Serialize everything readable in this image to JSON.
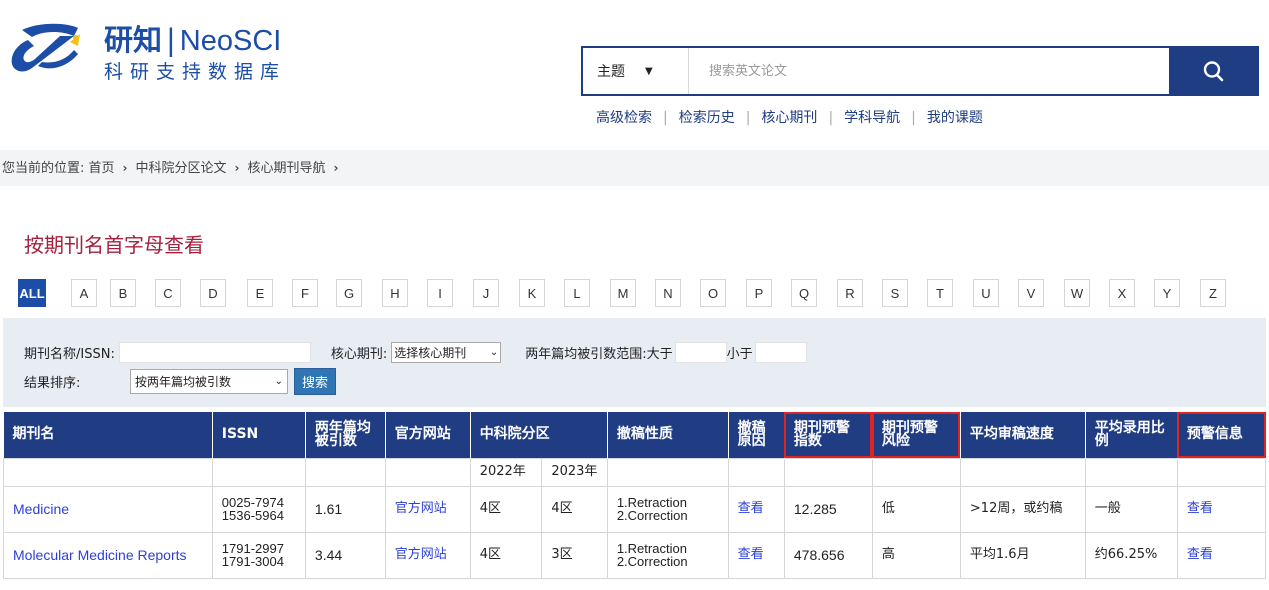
{
  "header": {
    "brand_name": "研知",
    "brand_en": "NeoSCI",
    "brand_sub": "科研支持数据库",
    "search": {
      "type_selected": "主题",
      "placeholder": "搜索英文论文"
    },
    "links": [
      "高级检索",
      "检索历史",
      "核心期刊",
      "学科导航",
      "我的课题"
    ]
  },
  "breadcrumb": {
    "prefix": "您当前的位置:",
    "items": [
      "首页",
      "中科院分区论文",
      "核心期刊导航"
    ]
  },
  "letter_nav": {
    "title": "按期刊名首字母查看",
    "letters": [
      "ALL",
      "A",
      "B",
      "C",
      "D",
      "E",
      "F",
      "G",
      "H",
      "I",
      "J",
      "K",
      "L",
      "M",
      "N",
      "O",
      "P",
      "Q",
      "R",
      "S",
      "T",
      "U",
      "V",
      "W",
      "X",
      "Y",
      "Z"
    ],
    "active": "ALL"
  },
  "filters": {
    "name_label": "期刊名称/ISSN:",
    "name_value": "",
    "core_label": "核心期刊:",
    "core_selected": "选择核心期刊",
    "cite_label": "两年篇均被引数范围:大于",
    "cite_min": "",
    "cite_less_label": "小于",
    "cite_max": "",
    "sort_label": "结果排序:",
    "sort_selected": "按两年篇均被引数",
    "search_button": "搜索"
  },
  "table": {
    "headers": {
      "name": "期刊名",
      "issn": "ISSN",
      "cites": "两年篇均被引数",
      "site": "官方网站",
      "cas": "中科院分区",
      "retract_type": "撤稿性质",
      "retract_reason": "撤稿原因",
      "warn_index": "期刊预警指数",
      "warn_risk": "期刊预警风险",
      "speed": "平均审稿速度",
      "accept": "平均录用比例",
      "warn_info": "预警信息"
    },
    "sub_headers": [
      "2022年",
      "2023年"
    ],
    "rows": [
      {
        "name": "Medicine",
        "issn1": "0025-7974",
        "issn2": "1536-5964",
        "cites": "1.61",
        "site": "官方网站",
        "cas2022": "4区",
        "cas2023": "4区",
        "retract1": "1.Retraction",
        "retract2": "2.Correction",
        "reason": "查看",
        "warn_index": "12.285",
        "warn_risk": "低",
        "speed": ">12周，或约稿",
        "accept": "一般",
        "warn_info": "查看"
      },
      {
        "name": "Molecular Medicine Reports",
        "issn1": "1791-2997",
        "issn2": "1791-3004",
        "cites": "3.44",
        "site": "官方网站",
        "cas2022": "4区",
        "cas2023": "3区",
        "retract1": "1.Retraction",
        "retract2": "2.Correction",
        "reason": "查看",
        "warn_index": "478.656",
        "warn_risk": "高",
        "speed": "平均1.6月",
        "accept": "约66.25%",
        "warn_info": "查看"
      }
    ]
  }
}
